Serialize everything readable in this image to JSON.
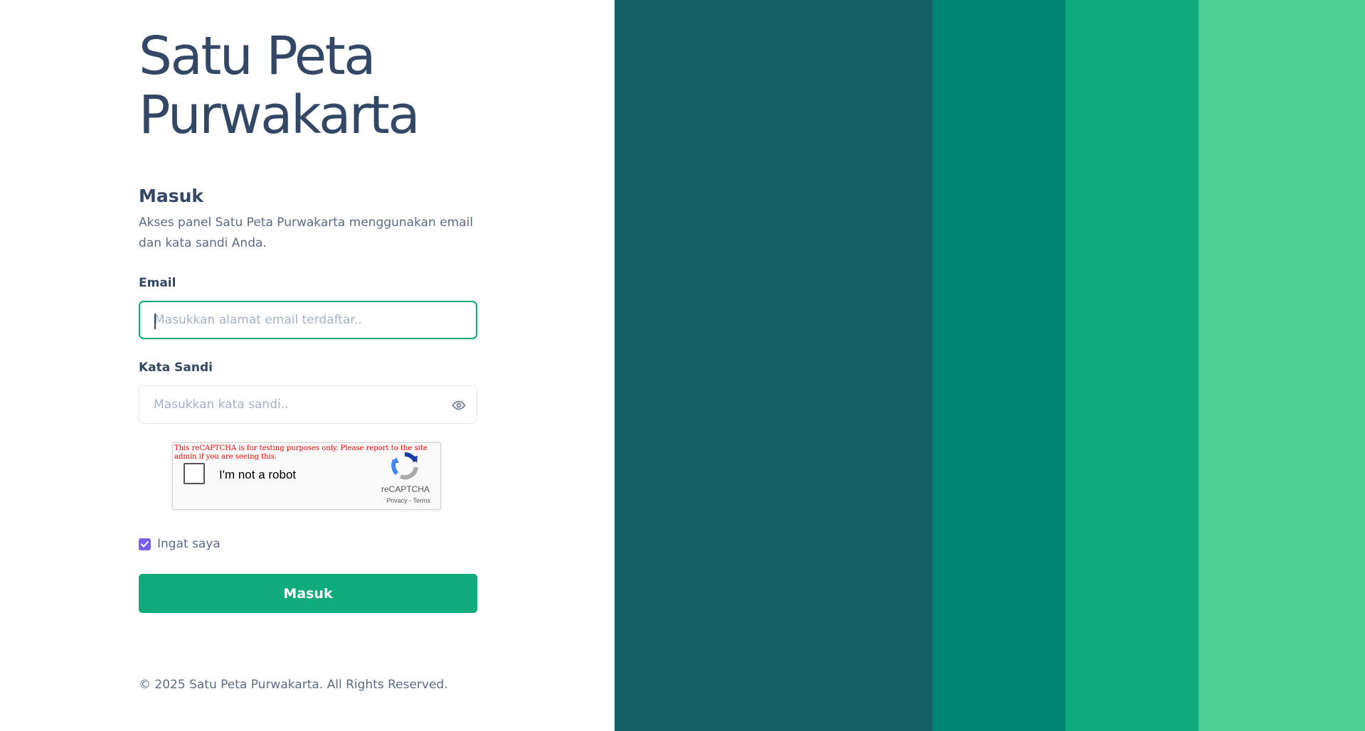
{
  "brand": {
    "line1": "Satu Peta",
    "line2": "Purwakarta"
  },
  "login": {
    "heading": "Masuk",
    "subtitle": "Akses panel Satu Peta Purwakarta menggunakan email dan kata sandi Anda.",
    "email_label": "Email",
    "email_placeholder": "Masukkan alamat email terdaftar..",
    "email_value": "",
    "password_label": "Kata Sandi",
    "password_placeholder": "Masukkan kata sandi..",
    "password_value": "",
    "password_toggle_icon": "eye-icon",
    "remember_label": "Ingat saya",
    "remember_checked": true,
    "submit_label": "Masuk"
  },
  "recaptcha": {
    "warning": "This reCAPTCHA is for testing purposes only. Please report to the site admin if you are seeing this.",
    "label": "I'm not a robot",
    "brand": "reCAPTCHA",
    "privacy": "Privacy",
    "separator": " - ",
    "terms": "Terms",
    "icon": "recaptcha-logo-icon"
  },
  "footer": {
    "text": "© 2025 Satu Peta Purwakarta. All Rights Reserved."
  },
  "colors": {
    "text_dark": "#334766",
    "text_muted": "#5b6b85",
    "accent": "#10ab7d",
    "checkbox": "#7a5cf0",
    "stripes": [
      "#155f66",
      "#008370",
      "#10ab7d",
      "#4bcc93"
    ]
  }
}
